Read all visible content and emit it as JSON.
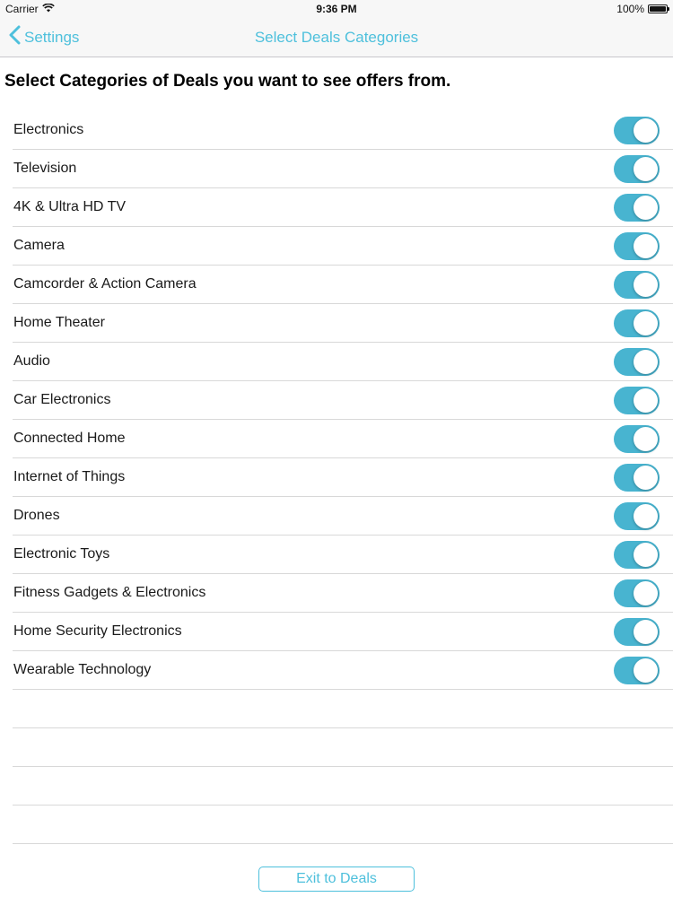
{
  "status_bar": {
    "carrier": "Carrier",
    "time": "9:36 PM",
    "battery": "100%",
    "battery_level": 1.0
  },
  "nav": {
    "back_label": "Settings",
    "title": "Select Deals Categories"
  },
  "instruction": "Select Categories of Deals you want to see offers from.",
  "categories": [
    {
      "label": "Electronics",
      "enabled": true
    },
    {
      "label": "Television",
      "enabled": true
    },
    {
      "label": "4K & Ultra HD TV",
      "enabled": true
    },
    {
      "label": "Camera",
      "enabled": true
    },
    {
      "label": "Camcorder & Action Camera",
      "enabled": true
    },
    {
      "label": "Home Theater",
      "enabled": true
    },
    {
      "label": "Audio",
      "enabled": true
    },
    {
      "label": "Car Electronics",
      "enabled": true
    },
    {
      "label": "Connected Home",
      "enabled": true
    },
    {
      "label": "Internet of Things",
      "enabled": true
    },
    {
      "label": "Drones",
      "enabled": true
    },
    {
      "label": "Electronic Toys",
      "enabled": true
    },
    {
      "label": "Fitness Gadgets & Electronics",
      "enabled": true
    },
    {
      "label": "Home Security Electronics",
      "enabled": true
    },
    {
      "label": "Wearable Technology",
      "enabled": true
    }
  ],
  "exit_button": "Exit to Deals",
  "colors": {
    "accent": "#4ec0dc",
    "toggle_on": "#48b4d0"
  },
  "icons": {
    "wifi": "wifi-icon",
    "back": "chevron-left-icon",
    "battery": "battery-icon"
  }
}
